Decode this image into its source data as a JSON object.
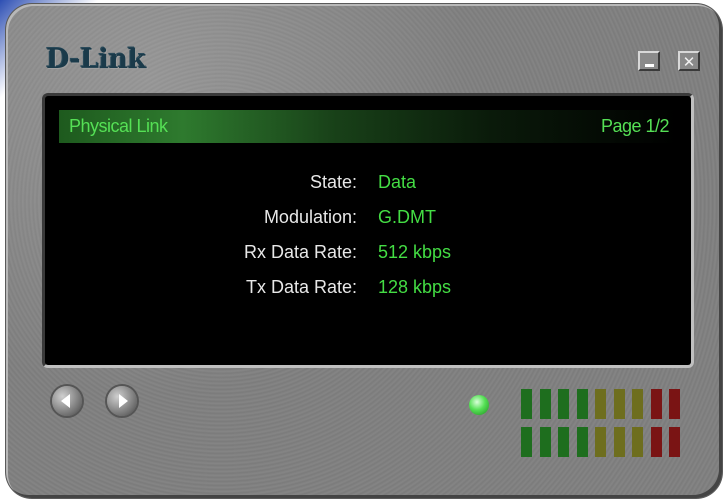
{
  "window": {
    "brand": "D-Link",
    "minimize_label": "",
    "close_label": "✕"
  },
  "display": {
    "title": "Physical Link",
    "page": "Page 1/2",
    "rows": [
      {
        "label": "State:",
        "value": "Data"
      },
      {
        "label": "Modulation:",
        "value": "G.DMT"
      },
      {
        "label": "Rx Data Rate:",
        "value": "512 kbps"
      },
      {
        "label": "Tx Data Rate:",
        "value": "128 kbps"
      }
    ]
  },
  "status": {
    "led_color": "#55e055"
  },
  "signal_meter": {
    "rows": 2,
    "segments_per_row": 9,
    "colors": [
      "#1e6e1e",
      "#1e6e1e",
      "#1e6e1e",
      "#1e6e1e",
      "#6e6e1e",
      "#6e6e1e",
      "#6e6e1e",
      "#7a1414",
      "#7a1414"
    ]
  },
  "icons": {
    "prev": "chevron-left-icon",
    "next": "chevron-right-icon"
  }
}
